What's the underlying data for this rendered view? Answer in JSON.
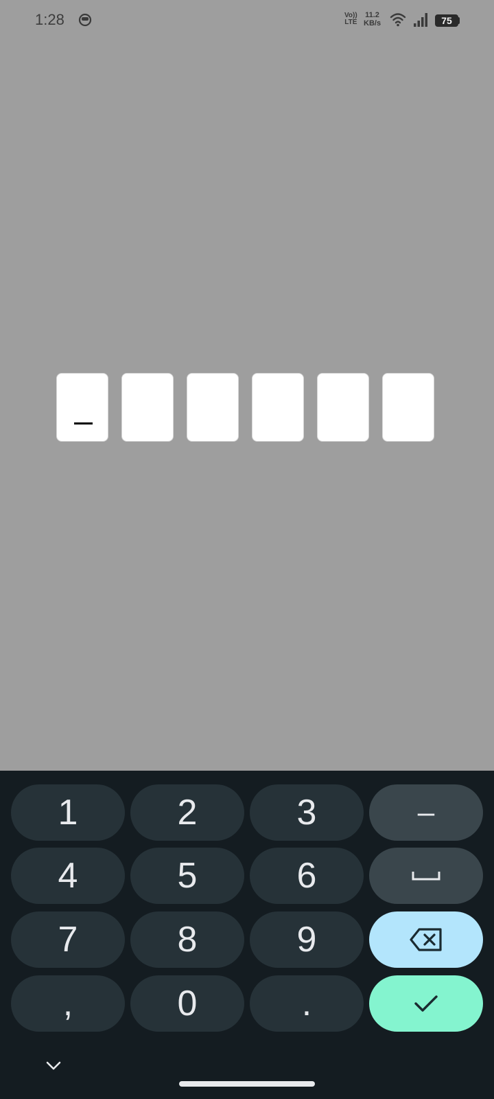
{
  "status_bar": {
    "time": "1:28",
    "volte_line1": "Vo))",
    "volte_line2": "LTE",
    "speed_value": "11.2",
    "speed_unit": "KB/s",
    "battery": "75"
  },
  "otp": {
    "length": 6,
    "values": [
      "",
      "",
      "",
      "",
      "",
      ""
    ]
  },
  "keyboard": {
    "rows": [
      [
        "1",
        "2",
        "3",
        "–"
      ],
      [
        "4",
        "5",
        "6",
        "␣"
      ],
      [
        "7",
        "8",
        "9",
        "backspace"
      ],
      [
        ",",
        "0",
        ".",
        "enter"
      ]
    ],
    "key_1": "1",
    "key_2": "2",
    "key_3": "3",
    "key_dash": "–",
    "key_4": "4",
    "key_5": "5",
    "key_6": "6",
    "key_7": "7",
    "key_8": "8",
    "key_9": "9",
    "key_comma": ",",
    "key_0": "0",
    "key_period": ".",
    "colors": {
      "background": "#141c21",
      "key": "#263238",
      "function_key": "#3a464c",
      "backspace": "#b3e5fc",
      "enter": "#84f4cf"
    }
  }
}
